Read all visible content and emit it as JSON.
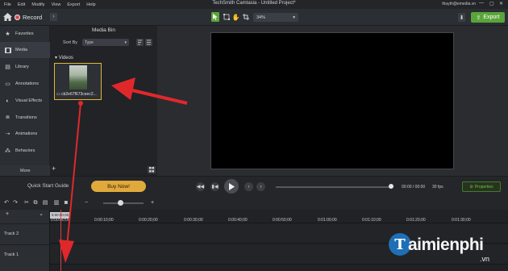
{
  "menubar": {
    "items": [
      "File",
      "Edit",
      "Modify",
      "View",
      "Export",
      "Help"
    ],
    "app_title": "TechSmith Camtasia - Untitled Project*",
    "user_email": "thuyth@emedia.vn",
    "window_controls": [
      "—",
      "▢",
      "✕"
    ]
  },
  "toolbar": {
    "record_label": "Record",
    "zoom_value": "34%",
    "export_label": "Export"
  },
  "sidebar": {
    "items": [
      {
        "label": "Favorites",
        "icon": "star-icon"
      },
      {
        "label": "Media",
        "icon": "film-icon"
      },
      {
        "label": "Library",
        "icon": "library-icon"
      },
      {
        "label": "Annotations",
        "icon": "annotation-icon"
      },
      {
        "label": "Visual Effects",
        "icon": "effects-icon"
      },
      {
        "label": "Transitions",
        "icon": "transitions-icon"
      },
      {
        "label": "Animations",
        "icon": "animation-icon"
      },
      {
        "label": "Behaviors",
        "icon": "behaviors-icon"
      }
    ],
    "more_label": "More"
  },
  "media_bin": {
    "title": "Media Bin",
    "sort_by_label": "Sort By",
    "sort_value": "Type",
    "section_label": "Videos",
    "clip_name": "cb2e67f673ceec2..."
  },
  "controls": {
    "quick_start_label": "Quick Start Guide",
    "buy_now_label": "Buy Now!",
    "time_readout": "00:00 / 00:00",
    "fps_readout": "30 fps",
    "properties_label": "Properties"
  },
  "timeline": {
    "playhead_time": "0:00:00;00",
    "ruler_ticks": [
      "0:00:00;00",
      "0:00:10;00",
      "0:00:20;00",
      "0:00:30;00",
      "0:00:40;00",
      "0:00:50;00",
      "0:01:00;00",
      "0:01:10;00",
      "0:01:20;00",
      "0:01:30;00"
    ],
    "tracks": [
      "Track 2",
      "Track 1"
    ]
  },
  "watermark": {
    "logo_letter": "T",
    "brand": "aimienphi",
    "domain": ".vn"
  },
  "colors": {
    "accent_green": "#5aa53a",
    "buy_now": "#e1a93c",
    "arrow_red": "#e0282b",
    "selection_gold": "#e1b43a"
  }
}
